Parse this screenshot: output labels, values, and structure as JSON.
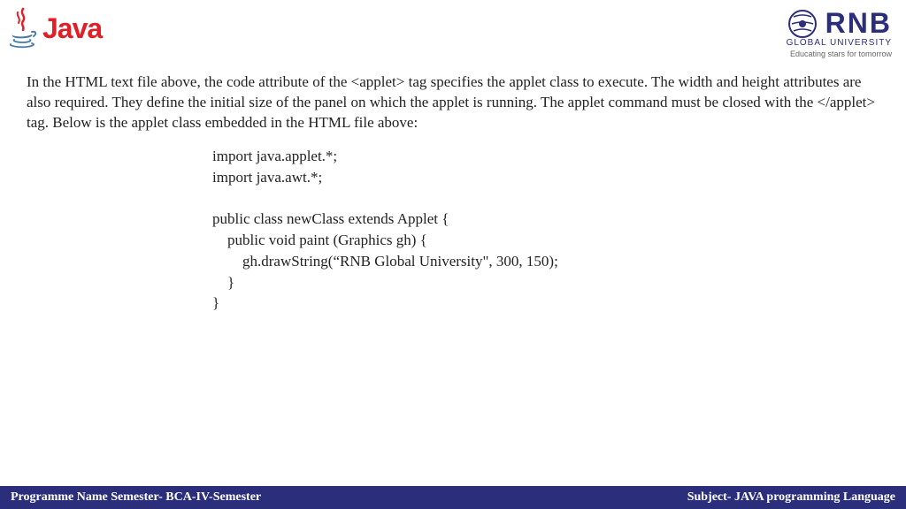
{
  "header": {
    "java_label": "Java",
    "rnb_name": "RNB",
    "rnb_sub": "GLOBAL UNIVERSITY",
    "rnb_tag": "Educating stars for tomorrow"
  },
  "content": {
    "paragraph": "In the HTML text file above, the code attribute of the <applet> tag specifies the applet class to execute. The width and height attributes are also required. They define the initial size of the panel on which the applet is running. The applet command must be closed with the </applet> tag. Below is the applet class embedded in the HTML file above:",
    "code": "import java.applet.*;\nimport java.awt.*;\n\npublic class newClass extends Applet {\n    public void paint (Graphics gh) {\n        gh.drawString(“RNB Global University\", 300, 150);\n    }\n}"
  },
  "footer": {
    "left": "Programme Name Semester- BCA-IV-Semester",
    "right": "Subject- JAVA programming Language"
  }
}
